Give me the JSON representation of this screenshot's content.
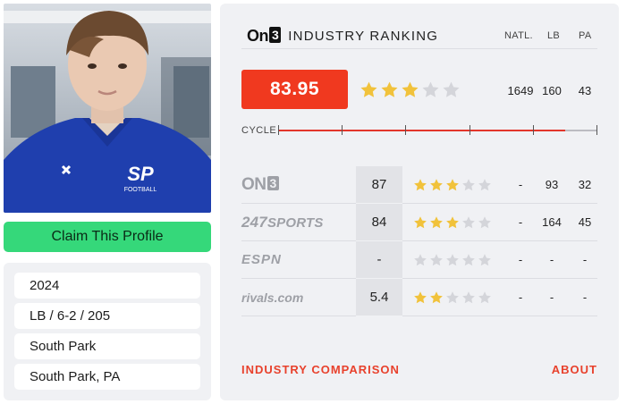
{
  "player": {
    "claim_label": "Claim This Profile",
    "info": [
      "2024",
      "LB / 6-2 / 205",
      "South Park",
      "South Park, PA"
    ],
    "photo_text": "SP",
    "photo_subtext": "FOOTBALL"
  },
  "ranking": {
    "brand": "On3",
    "brand_three": "3",
    "brand_on": "On",
    "title": "INDUSTRY RANKING",
    "columns": [
      "NATL.",
      "LB",
      "PA"
    ],
    "score": "83.95",
    "stars": 3,
    "natl": "1649",
    "pos": "160",
    "state": "43",
    "cycle_label": "CYCLE",
    "cycle_progress": 0.9
  },
  "services": [
    {
      "name": "On3",
      "logo_a": "ON",
      "logo_b": "3",
      "score": "87",
      "stars": 3,
      "natl": "-",
      "pos": "93",
      "state": "32"
    },
    {
      "name": "247Sports",
      "logo_a": "247",
      "logo_b": "SPORTS",
      "score": "84",
      "stars": 3,
      "natl": "-",
      "pos": "164",
      "state": "45"
    },
    {
      "name": "ESPN",
      "logo_a": "ESPN",
      "logo_b": "",
      "score": "-",
      "stars": 0,
      "natl": "-",
      "pos": "-",
      "state": "-"
    },
    {
      "name": "Rivals",
      "logo_a": "rivals.com",
      "logo_b": "",
      "score": "5.4",
      "stars": 2,
      "natl": "-",
      "pos": "-",
      "state": "-"
    }
  ],
  "footer": {
    "comparison_label": "INDUSTRY COMPARISON",
    "about_label": "ABOUT"
  },
  "colors": {
    "accent_red": "#f0391f",
    "claim_green": "#35d87a",
    "star_gold": "#f1c23b",
    "star_gray": "#d4d5da",
    "panel_bg": "#f0f1f4",
    "jersey_blue": "#1f3fae"
  }
}
